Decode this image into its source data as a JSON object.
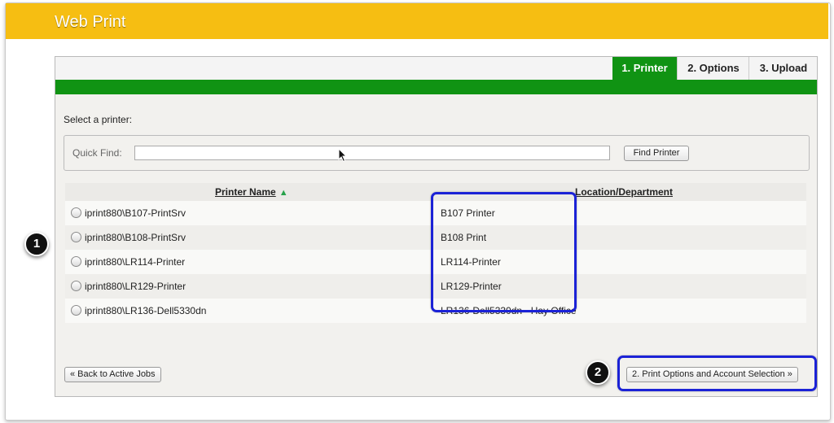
{
  "header": {
    "title": "Web Print"
  },
  "tabs": [
    {
      "label": "1. Printer",
      "active": true
    },
    {
      "label": "2. Options",
      "active": false
    },
    {
      "label": "3. Upload",
      "active": false
    }
  ],
  "main": {
    "select_label": "Select a printer:",
    "quick_find": {
      "label": "Quick Find:",
      "value": "",
      "button": "Find Printer"
    },
    "table": {
      "columns": [
        "Printer Name",
        "Location/Department"
      ],
      "sort_icon": "triangle-up",
      "rows": [
        {
          "name": "iprint880\\B107-PrintSrv",
          "location": "B107 Printer"
        },
        {
          "name": "iprint880\\B108-PrintSrv",
          "location": "B108 Print"
        },
        {
          "name": "iprint880\\LR114-Printer",
          "location": "LR114-Printer"
        },
        {
          "name": "iprint880\\LR129-Printer",
          "location": "LR129-Printer"
        },
        {
          "name": "iprint880\\LR136-Dell5330dn",
          "location": "LR136-Dell5330dn - Hay Office"
        }
      ]
    },
    "back_button": "« Back to Active Jobs",
    "next_button": "2. Print Options and Account Selection »"
  },
  "annotations": {
    "badge1": "1",
    "badge2": "2"
  },
  "colors": {
    "header": "#f6be12",
    "accent_green": "#109313",
    "highlight": "#1b22d6"
  }
}
